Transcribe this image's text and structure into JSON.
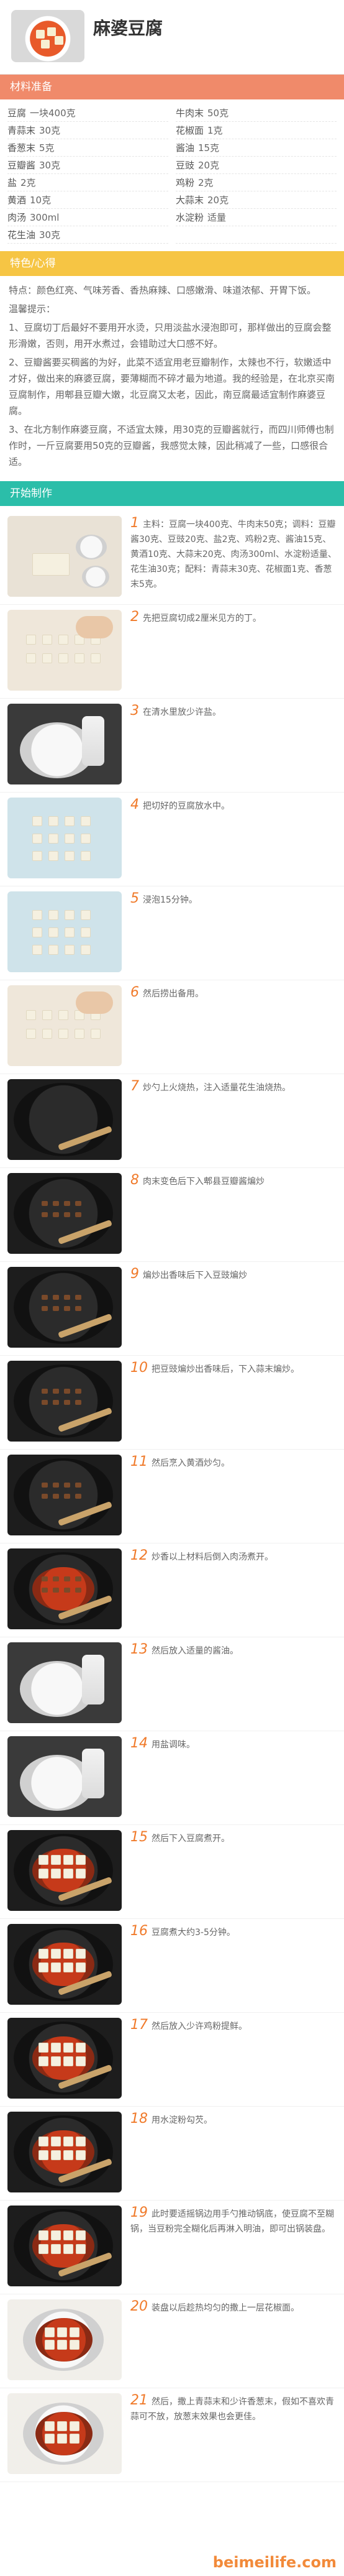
{
  "title": "麻婆豆腐",
  "sections": {
    "ingredients": "材料准备",
    "tips": "特色/心得",
    "steps": "开始制作"
  },
  "ingredients": [
    {
      "name": "豆腐",
      "amount": "一块400克"
    },
    {
      "name": "牛肉末",
      "amount": "50克"
    },
    {
      "name": "青蒜末",
      "amount": "30克"
    },
    {
      "name": "花椒面",
      "amount": "1克"
    },
    {
      "name": "香葱末",
      "amount": "5克"
    },
    {
      "name": "酱油",
      "amount": "15克"
    },
    {
      "name": "豆瓣酱",
      "amount": "30克"
    },
    {
      "name": "豆豉",
      "amount": "20克"
    },
    {
      "name": "盐",
      "amount": "2克"
    },
    {
      "name": "鸡粉",
      "amount": "2克"
    },
    {
      "name": "黄酒",
      "amount": "10克"
    },
    {
      "name": "大蒜末",
      "amount": "20克"
    },
    {
      "name": "肉汤",
      "amount": "300ml"
    },
    {
      "name": "水淀粉",
      "amount": "适量"
    },
    {
      "name": "花生油",
      "amount": "30克"
    },
    {
      "name": "",
      "amount": ""
    }
  ],
  "tips": [
    "特点：颜色红亮、气味芳香、香热麻辣、口感嫩滑、味道浓郁、开胃下饭。",
    "温馨提示：",
    "1、豆腐切丁后最好不要用开水烫，只用淡盐水浸泡即可，那样做出的豆腐会整形滑嫩，否则，用开水煮过，会错助过大口感不好。",
    "2、豆瓣酱要买稠酱的为好，此菜不适宜用老豆瓣制作，太辣也不行，软嫩适中才好，做出来的麻婆豆腐，要薄糊而不碎才最为地道。我的经验是，在北京买南豆腐制作，用郫县豆瓣大嫩，北豆腐又太老，因此，南豆腐最适宜制作麻婆豆腐。",
    "3、在北方制作麻婆豆腐，不适宜太辣，用30克的豆瓣酱就行，而四川师傅也制作时，一斤豆腐要用50克的豆瓣酱，我感觉太辣，因此稍减了一些，口感很合适。"
  ],
  "steps": [
    {
      "num": "1",
      "text": "主料：豆腐一块400克、牛肉末50克；调料：豆瓣酱30克、豆豉20克、盐2克、鸡粉2克、酱油15克、黄酒10克、大蒜末20克、肉汤300ml、水淀粉适量、花生油30克；配料：青蒜末30克、花椒面1克、香葱末5克。"
    },
    {
      "num": "2",
      "text": "先把豆腐切成2厘米见方的丁。"
    },
    {
      "num": "3",
      "text": "在清水里放少许盐。"
    },
    {
      "num": "4",
      "text": "把切好的豆腐放水中。"
    },
    {
      "num": "5",
      "text": "浸泡15分钟。"
    },
    {
      "num": "6",
      "text": "然后捞出备用。"
    },
    {
      "num": "7",
      "text": "炒勺上火烧热，注入适量花生油烧热。"
    },
    {
      "num": "8",
      "text": "肉末变色后下入郫县豆瓣酱煸炒"
    },
    {
      "num": "9",
      "text": "煸炒出香味后下入豆豉煸炒"
    },
    {
      "num": "10",
      "text": "把豆豉煸炒出香味后，下入蒜末煸炒。"
    },
    {
      "num": "11",
      "text": "然后烹入黄酒炒匀。"
    },
    {
      "num": "12",
      "text": "炒香以上材料后倒入肉汤煮开。"
    },
    {
      "num": "13",
      "text": "然后放入适量的酱油。"
    },
    {
      "num": "14",
      "text": "用盐调味。"
    },
    {
      "num": "15",
      "text": "然后下入豆腐煮开。"
    },
    {
      "num": "16",
      "text": "豆腐煮大约3-5分钟。"
    },
    {
      "num": "17",
      "text": "然后放入少许鸡粉提鲜。"
    },
    {
      "num": "18",
      "text": "用水淀粉勾芡。"
    },
    {
      "num": "19",
      "text": "此时要适摇锅边用手勺推动锅底，使豆腐不至糊锅，当豆粉完全糊化后再淋入明油，即可出锅装盘。"
    },
    {
      "num": "20",
      "text": "装盘以后趁热均匀的撒上一层花椒面。"
    },
    {
      "num": "21",
      "text": "然后，撒上青蒜末和少许香葱末，假如不喜欢青蒜可不放，放葱末效果也会更佳。"
    }
  ],
  "watermark": "beimeilife.com"
}
